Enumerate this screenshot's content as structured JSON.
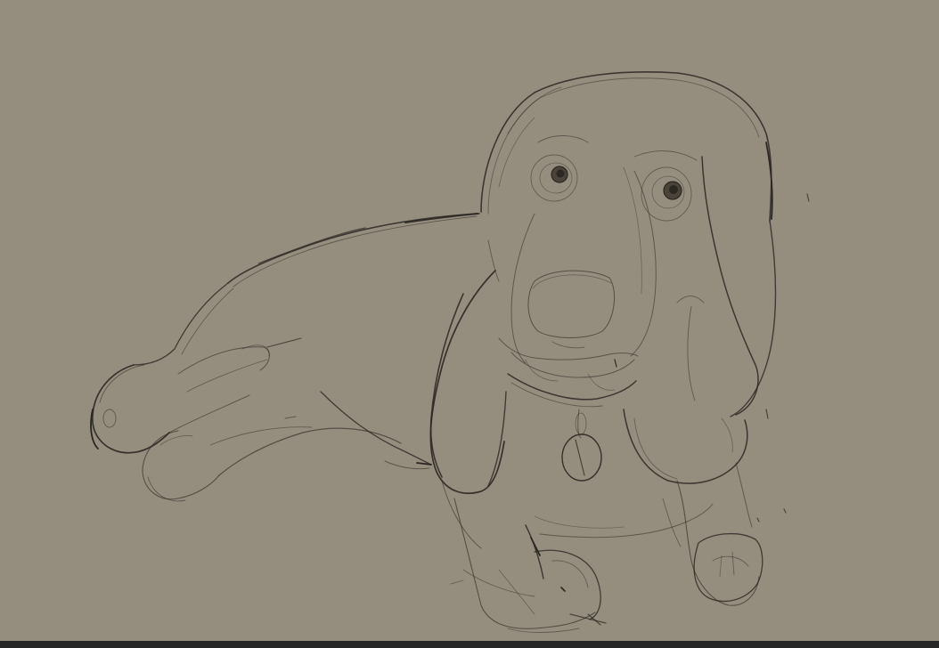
{
  "canvas": {
    "background": "#958d7e",
    "stroke_color": "#2b2722",
    "subject": "dog-sketch-icon"
  },
  "bottom_bar": {
    "color": "#262626"
  }
}
